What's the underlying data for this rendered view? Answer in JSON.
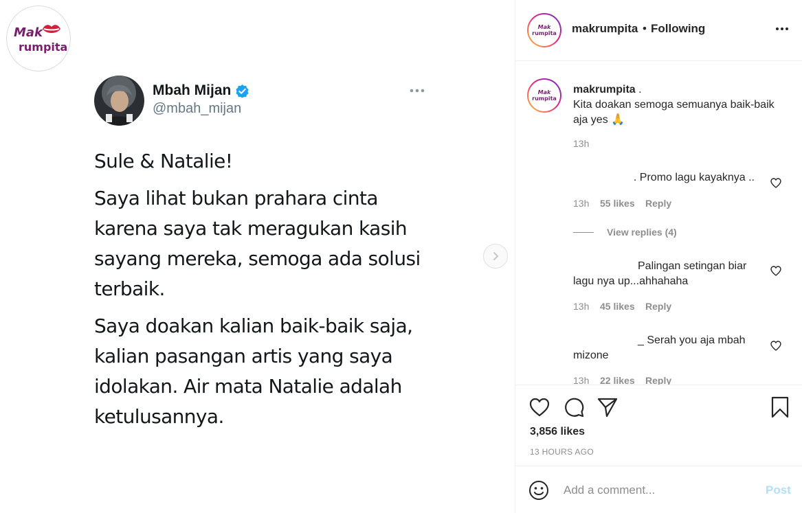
{
  "post_image": {
    "logo_top": "Mak",
    "logo_bottom": "rumpita",
    "tweet": {
      "name": "Mbah Mijan",
      "handle": "@mbah_mijan",
      "paragraphs": [
        "Sule & Natalie!",
        "Saya lihat bukan prahara cinta karena saya tak meragukan kasih sayang mereka, semoga ada solusi terbaik.",
        "Saya doakan kalian baik-baik saja, kalian pasangan artis yang saya idolakan. Air mata Natalie adalah ketulusannya."
      ]
    }
  },
  "header": {
    "username": "makrumpita",
    "dot": "•",
    "follow_status": "Following"
  },
  "caption": {
    "username": "makrumpita",
    "suffix": " .",
    "text": "Kita doakan semoga semuanya baik-baik aja yes 🙏",
    "time": "13h"
  },
  "comments": [
    {
      "text": ". Promo lagu kayaknya ..",
      "time": "13h",
      "likes": "55 likes",
      "reply": "Reply",
      "view_replies": "View replies (4)"
    },
    {
      "text": "Palingan setingan biar lagu nya up...ahhahaha",
      "time": "13h",
      "likes": "45 likes",
      "reply": "Reply"
    },
    {
      "text": "_ Serah you aja mbah mizone",
      "time": "13h",
      "likes": "22 likes",
      "reply": "Reply"
    }
  ],
  "actions": {
    "likes": "3,856 likes",
    "time_ago": "13 HOURS AGO"
  },
  "add_comment": {
    "placeholder": "Add a comment...",
    "post_label": "Post"
  },
  "colors": {
    "brand_purple": "#7b1e6e",
    "verified_blue": "#1da1f2",
    "post_disabled": "#b2dffc",
    "meta_gray": "#8e8e8e"
  }
}
